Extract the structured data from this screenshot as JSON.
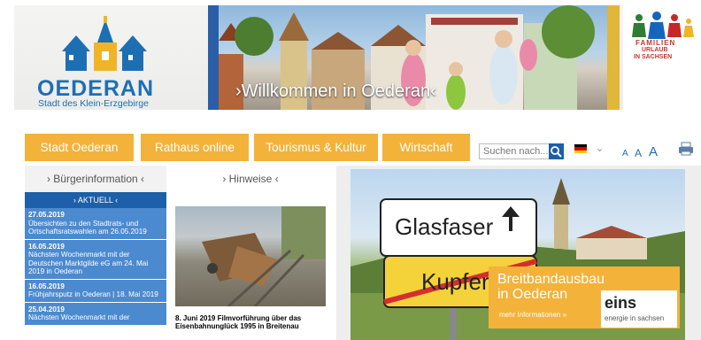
{
  "header": {
    "town_name": "OEDERAN",
    "town_subtitle": "Stadt des Klein-Erzgebirge",
    "welcome_text": "›Willkommen in Oederan‹",
    "family_logo": {
      "line1": "FAMILIEN",
      "line2": "URLAUB",
      "line3": "IN SACHSEN"
    }
  },
  "nav": {
    "items": [
      {
        "label": "Stadt Oederan"
      },
      {
        "label": "Rathaus online"
      },
      {
        "label": "Tourismus & Kultur"
      },
      {
        "label": "Wirtschaft"
      }
    ],
    "search_placeholder": "Suchen nach...",
    "font_sizes": [
      "A",
      "A",
      "A"
    ]
  },
  "left": {
    "tab_label": "› Bürgerinformation ‹",
    "section_label": "› AKTUELL ‹",
    "news": [
      {
        "date": "27.05.2019",
        "text": "Übersichten zu den Stadtrats- und Ortschaftsratswahlen am 26.05.2019"
      },
      {
        "date": "16.05.2019",
        "text": "Nächsten Wochenmarkt mit der Deutschen Marktgilde eG am 24. Mai 2019 in Oederan"
      },
      {
        "date": "16.05.2019",
        "text": "Frühjahrsputz in Oederan | 18. Mai 2019"
      },
      {
        "date": "25.04.2019",
        "text": "Nächsten Wochenmarkt mit der"
      }
    ]
  },
  "middle": {
    "tab_label": "› Hinweise ‹",
    "caption": "8. Juni 2019 Filmvorführung über das Eisenbahnunglück 1995 in Breitenau"
  },
  "banner": {
    "sign_top": "Glasfaser",
    "sign_bottom": "Kupfer",
    "title_line1": "Breitbandausbau",
    "title_line2": "in Oederan",
    "more_link": "mehr Informationen »",
    "partner_logo": "eins",
    "partner_sub": "energie in sachsen"
  },
  "colors": {
    "accent_orange": "#f3b23a",
    "brand_blue": "#1d5fa8",
    "news_blue": "#4c8ad0"
  }
}
